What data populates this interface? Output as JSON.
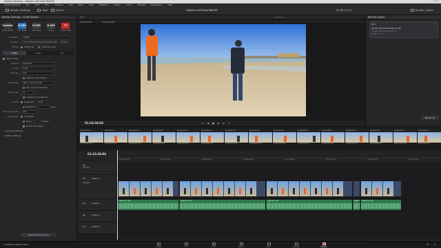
{
  "window_title": "DaVinci Resolve - Hoheim mt2 Final MAC05",
  "menu": [
    "DaVinci Resolve",
    "File",
    "Edit",
    "Trim",
    "Timeline",
    "Clip",
    "Mark",
    "View",
    "Playback",
    "Fusion",
    "Color",
    "Fairlight",
    "Workspace",
    "Help"
  ],
  "toolbar": {
    "render_settings": "Render Settings",
    "clips_label": "Clips",
    "project_title": "Hoheim mt2 Final MAC05",
    "timecode_top": "07:08:17:24",
    "render_queue": "Render Queue"
  },
  "render_settings": {
    "header": "Render Settings - H.264 Master",
    "presets": [
      {
        "box": "Custom",
        "lbl": "Custom Export",
        "color": "#3a3b3e"
      },
      {
        "box": "H.264",
        "lbl": "H.264 Master",
        "color": "#2d6fb5"
      },
      {
        "box": "H.265",
        "lbl": "H.265 Master",
        "color": "#3a3b3e"
      },
      {
        "box": "H.264",
        "lbl": "YouTube",
        "color": "#3a3b3e"
      },
      {
        "box": "YT",
        "lbl": "YouTube 1080p",
        "color": "#c32b2b"
      }
    ],
    "filename_label": "File Name",
    "filename": "Untitled",
    "location_label": "Location",
    "location": "C:\\Users\\Hohem\\Google Drive\\Workshop",
    "browse": "Browse",
    "render_label": "Render",
    "single_clip": "Single clip",
    "individual_clips": "Individual clips",
    "tabs": [
      "Video",
      "Audio",
      "File"
    ],
    "export_video": "Export Video",
    "format_label": "Format",
    "format": "QuickTime",
    "codec_label": "Codec",
    "codec": "H.264",
    "encoder_label": "Encoder",
    "encoder": "Auto",
    "network_opt": "Network Optimization",
    "resolution_label": "Resolution",
    "resolution": "3840 x 2160 Ultra HD",
    "field_rendering": "Use vertical resolution",
    "framerate_label": "Frame rate",
    "framerate": "25",
    "chapters": "Chapters from Markers",
    "quality_label": "Quality",
    "automatic": "Automatic",
    "best": "Best",
    "restrict_to": "Restrict to",
    "kbps": "Kb/s",
    "encoding_profile_label": "Encoding Profile",
    "encoding_profile": "Auto",
    "keyframes_label": "Key Frames",
    "keyframes_auto": "Automatic",
    "every": "Every",
    "frames": "frames",
    "frame_reorder": "Frame reordering",
    "advanced": "Advanced Settings",
    "subtitle": "Subtitle Settings",
    "add_queue": "Add to Render Queue"
  },
  "viewer": {
    "zoom": "37%",
    "tc_left": "01:00:00:00",
    "tc_out": "01:16:34:04",
    "timeline_name": "Timeline 1",
    "tc_main": "01:16:34:04"
  },
  "render_queue": {
    "job_label": "Job 1",
    "job_title": "Hoheim mt2 Final MAC05 | H.264",
    "job_path": "C:\\Users\\Hohem\\Google Drive\\...",
    "job_note": "Render 1 of 1",
    "render_all": "Render All"
  },
  "thumbs": [
    {
      "tc": "00:14:25:15",
      "ft": "H.264 High L5.1"
    },
    {
      "tc": "00:14:35:19",
      "ft": "H.264 High L5.1"
    },
    {
      "tc": "00:14:48:13",
      "ft": "H.264 High L5.1"
    },
    {
      "tc": "00:14:52:07",
      "ft": "H.264 High L5.1"
    },
    {
      "tc": "00:14:57:05",
      "ft": "H.264 High L5.1"
    },
    {
      "tc": "00:14:56:04",
      "ft": "H.264 High L5.1"
    },
    {
      "tc": "00:15:03:24",
      "ft": "H.264 High L5.1"
    },
    {
      "tc": "00:15:01:14",
      "ft": "H.264 High L5.1"
    },
    {
      "tc": "00:16:13:03",
      "ft": "H.264 High L5.1"
    },
    {
      "tc": "00:06:20:05",
      "ft": "H.264 High L5.1"
    },
    {
      "tc": "00:06:18:01",
      "ft": "H.264 High L5.1"
    },
    {
      "tc": "00:08:22:08",
      "ft": "H.264 High L5.1"
    },
    {
      "tc": "00:13:20:16",
      "ft": "H.264 High L5.1"
    },
    {
      "tc": "07:07:20:17",
      "ft": "H.264 High L5.1"
    },
    {
      "tc": "07:07:42:20",
      "ft": "H.264 High L5.1"
    }
  ],
  "timeline": {
    "tc": "01:16:34:04",
    "ruler": [
      "01:00:00:00",
      "01:03:00:00",
      "01:06:00:00",
      "01:09:00:00",
      "01:12:00:00",
      "01:15:00:00",
      "01:18:00:00",
      "01:21:00:00"
    ],
    "v2": "V2",
    "v1": "V1",
    "v1_label": "Video 1",
    "a1": "A1",
    "a1_label": "Audio 1",
    "a2": "A2",
    "a2_label": "Audio 2",
    "a3": "A3",
    "a3_label": "Audio 3",
    "clips_count": "20 Clips",
    "a_clip_name": "Audio 1.0 - 2.0"
  },
  "pages": [
    {
      "label": "Media",
      "on": false
    },
    {
      "label": "Cut",
      "on": false
    },
    {
      "label": "Edit",
      "on": false
    },
    {
      "label": "Fusion",
      "on": false
    },
    {
      "label": "Color",
      "on": false
    },
    {
      "label": "Fairlight",
      "on": false
    },
    {
      "label": "Deliver",
      "on": true
    }
  ],
  "app_name": "DaVinci Resolve 16.4"
}
